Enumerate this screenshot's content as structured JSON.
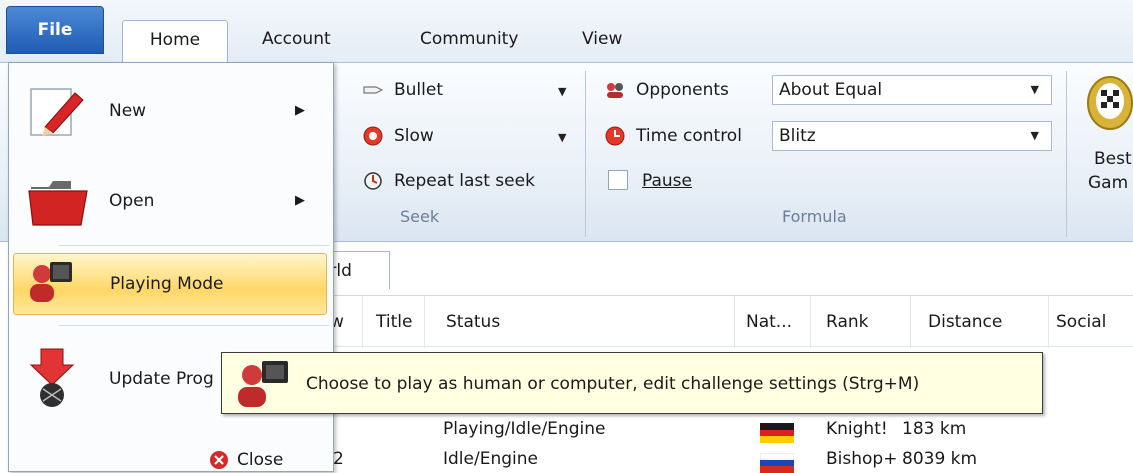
{
  "tabs": {
    "file": "File",
    "home": "Home",
    "account": "Account",
    "community": "Community",
    "view": "View"
  },
  "ribbon": {
    "seek": {
      "bullet": "Bullet",
      "slow": "Slow",
      "repeat": "Repeat last seek",
      "group_label": "Seek"
    },
    "formula": {
      "opponents_label": "Opponents",
      "opponents_value": "About Equal",
      "time_control_label": "Time control",
      "time_control_value": "Blitz",
      "pause_label": "Pause",
      "group_label": "Formula"
    },
    "best_games": {
      "line1": "Best",
      "line2": "Gam"
    }
  },
  "list": {
    "tab_label": "orld",
    "columns": [
      "w",
      "Title",
      "Status",
      "Nat...",
      "Rank",
      "Distance",
      "Social"
    ],
    "rows": [
      {
        "status": "Playing/Idle/Engine",
        "flag": "de",
        "rank": "Knight!",
        "distance": "183 km"
      },
      {
        "prefix": "2",
        "status": "Idle/Engine",
        "flag": "ru",
        "rank": "Bishop+",
        "distance": "8039 km"
      }
    ]
  },
  "file_menu": {
    "items": [
      {
        "label": "New",
        "icon": "pencil-icon",
        "has_submenu": true
      },
      {
        "label": "Open",
        "icon": "folder-icon",
        "has_submenu": true
      },
      {
        "label": "Playing Mode",
        "icon": "playing-mode-icon",
        "selected": true
      },
      {
        "label": "Update Prog",
        "icon": "update-icon"
      }
    ],
    "close_label": "Close"
  },
  "tooltip": {
    "text": "Choose to play as human or computer, edit challenge settings (Strg+M)"
  },
  "colors": {
    "file_tab": "#2a6bc4",
    "selected_item": "#ffd767",
    "tooltip_bg": "#ffffe1",
    "ribbon_bg": "#e7eef6"
  }
}
